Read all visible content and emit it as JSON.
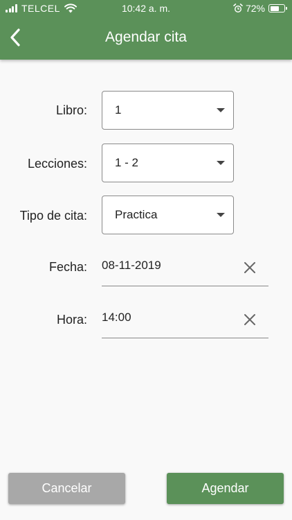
{
  "status_bar": {
    "carrier": "TELCEL",
    "time": "10:42 a. m.",
    "battery": "72%",
    "battery_level": 0.72,
    "icons": [
      "signal-icon",
      "wifi-icon",
      "alarm-icon",
      "battery-icon"
    ]
  },
  "header": {
    "title": "Agendar cita",
    "back_icon": "chevron-left-icon"
  },
  "form": {
    "libro": {
      "label": "Libro:",
      "value": "1"
    },
    "lecciones": {
      "label": "Lecciones:",
      "value": "1 - 2"
    },
    "tipo": {
      "label": "Tipo de cita:",
      "value": "Practica"
    },
    "fecha": {
      "label": "Fecha:",
      "value": "08-11-2019"
    },
    "hora": {
      "label": "Hora:",
      "value": "14:00"
    }
  },
  "actions": {
    "cancel_label": "Cancelar",
    "submit_label": "Agendar"
  },
  "colors": {
    "primary": "#5b9159",
    "cancel": "#a8a8a8",
    "background": "#f9f9f9"
  }
}
